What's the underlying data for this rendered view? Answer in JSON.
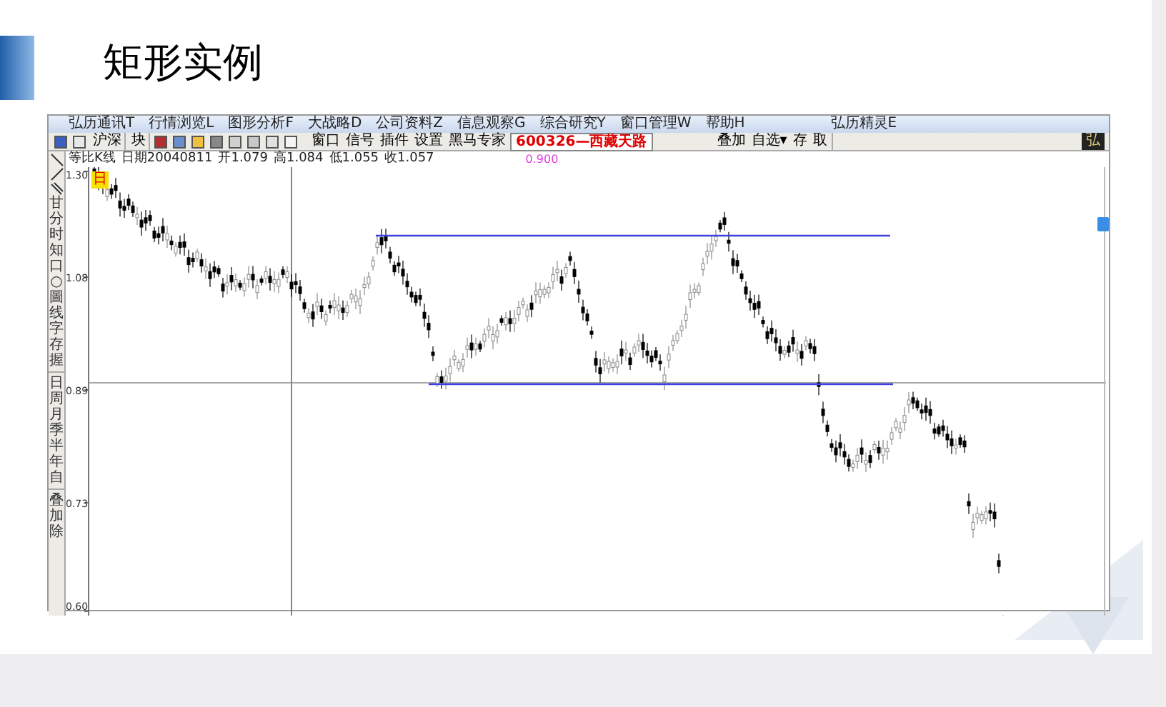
{
  "slide": {
    "title": "矩形实例"
  },
  "app": {
    "menu": [
      "弘历通讯T",
      "行情浏览L",
      "图形分析F",
      "大战略D",
      "公司资料Z",
      "信息观察G",
      "综合研究Y",
      "窗口管理W",
      "帮助H",
      "弘历精灵E"
    ],
    "toolbar": {
      "market": [
        "沪深",
        "块"
      ],
      "tools": [
        "窗口",
        "信号",
        "插件",
        "设置",
        "黑马专家"
      ],
      "stock": "600326—西藏天路",
      "actions": [
        "叠加",
        "自选▾",
        "存",
        "取"
      ],
      "brand": "弘"
    }
  },
  "info": {
    "items": [
      "等比K线",
      "日期20040811",
      "开1.079",
      "高1.084",
      "低1.055",
      "收1.057"
    ],
    "value": "0.900"
  },
  "period_badge": "日",
  "side_tools": [
    "甘",
    "分",
    "时",
    "知",
    "口",
    "○",
    "圖",
    "线",
    "字",
    "存",
    "握"
  ],
  "side_periods": [
    "日",
    "周",
    "月",
    "季",
    "半",
    "年",
    "自"
  ],
  "side_extra": [
    "叠",
    "加",
    "除"
  ],
  "y_axis": [
    "1.30",
    "1.08",
    "0.89",
    "0.73",
    "0.60"
  ]
}
